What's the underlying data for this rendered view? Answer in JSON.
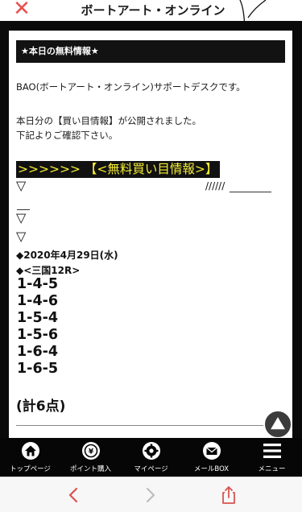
{
  "header": {
    "close_icon": "close-x-icon",
    "title": "ボートアート・オンライン"
  },
  "content": {
    "info_header": "★本日の無料情報★",
    "intro": "BAO(ボートアート・オンライン)サポートデスクです。",
    "notice_line1": "本日分の【買い目情報】が公開されました。",
    "notice_line2": "下記よりご確認下さい。",
    "free_link": ">>>>>> 【<無料買い目情報>】",
    "triangle": "▽",
    "slashes": "//////",
    "race_date": "◆2020年4月29日(水)",
    "race_venue": "◆<三国12R>",
    "combos": [
      "1-4-5",
      "1-4-6",
      "1-5-4",
      "1-5-6",
      "1-6-4",
      "1-6-5"
    ],
    "total": "(計6点)"
  },
  "nav": {
    "items": [
      {
        "label": "トップページ",
        "icon": "home-icon"
      },
      {
        "label": "ポイント購入",
        "icon": "coin-icon"
      },
      {
        "label": "マイページ",
        "icon": "gear-icon"
      },
      {
        "label": "メールBOX",
        "icon": "mail-icon"
      },
      {
        "label": "メニュー",
        "icon": "menu-icon"
      }
    ]
  },
  "colors": {
    "accent_red": "#e8514e",
    "frame_black": "#0a0a0a",
    "link_yellow": "#f7ee33",
    "browser_red": "#d9534f"
  }
}
